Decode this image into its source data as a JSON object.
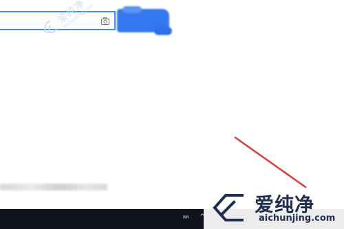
{
  "search": {
    "value": "",
    "placeholder": ""
  },
  "search_button": {
    "label": ""
  },
  "watermark_small": {
    "text": "爱纯净",
    "url": "aichunjing.com"
  },
  "brand": {
    "name": "爱纯净",
    "url": "aichunjing.com"
  },
  "taskbar": {
    "tray_people": "ᴿᴿ",
    "tray_chevron": "^"
  },
  "colors": {
    "search_border": "#3f8cf0",
    "search_button": "#3478ef",
    "taskbar": "#10121a",
    "arrow": "#d93a3a",
    "brand_text": "#1f2d4f"
  }
}
